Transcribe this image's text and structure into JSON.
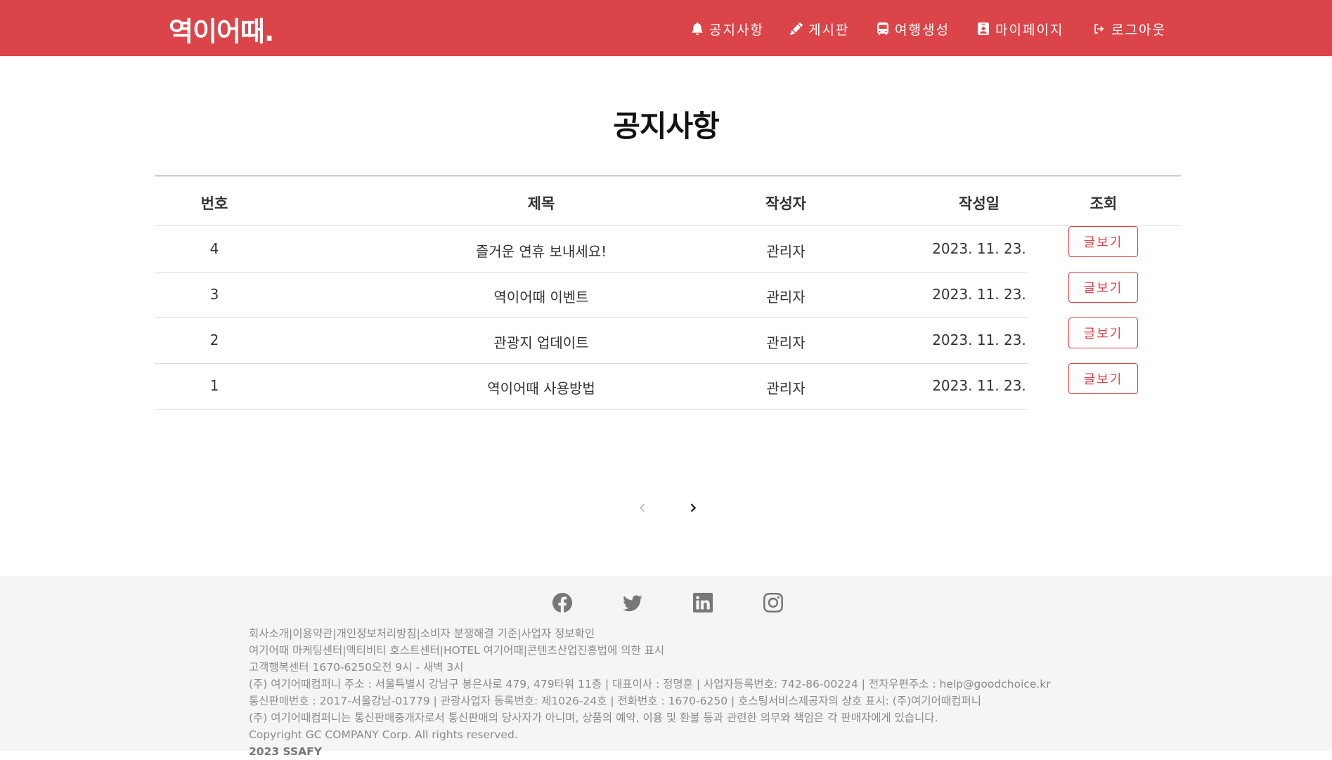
{
  "header": {
    "brand": "역이어때.",
    "nav": [
      {
        "label": "공지사항",
        "icon": "bell-icon"
      },
      {
        "label": "게시판",
        "icon": "pencil-icon"
      },
      {
        "label": "여행생성",
        "icon": "bus-icon"
      },
      {
        "label": "마이페이지",
        "icon": "user-badge-icon"
      },
      {
        "label": "로그아웃",
        "icon": "logout-icon"
      }
    ]
  },
  "page": {
    "title": "공지사항"
  },
  "table": {
    "headers": [
      "번호",
      "제목",
      "작성자",
      "작성일",
      "조회"
    ],
    "rows": [
      {
        "no": "4",
        "title": "즐거운 연휴 보내세요!",
        "author": "관리자",
        "date": "2023. 11. 23.",
        "action": "글보기"
      },
      {
        "no": "3",
        "title": "역이어때 이벤트",
        "author": "관리자",
        "date": "2023. 11. 23.",
        "action": "글보기"
      },
      {
        "no": "2",
        "title": "관광지 업데이트",
        "author": "관리자",
        "date": "2023. 11. 23.",
        "action": "글보기"
      },
      {
        "no": "1",
        "title": "역이어때 사용방법",
        "author": "관리자",
        "date": "2023. 11. 23.",
        "action": "글보기"
      }
    ]
  },
  "pagination": {
    "prev_icon": "chevron-left-icon",
    "next_icon": "chevron-right-icon"
  },
  "footer": {
    "socials": [
      "facebook-icon",
      "twitter-icon",
      "linkedin-icon",
      "instagram-icon"
    ],
    "links": [
      "회사소개",
      "이용약관",
      "개인정보처리방침",
      "소비자 분쟁해결 기준",
      "사업자 정보확인"
    ],
    "lines": [
      "여기어때 마케팅센터|액티비티 호스트센터|HOTEL 여기어때|콘텐츠산업진흥법에 의한 표시",
      "고객행복센터 1670-6250오전 9시 - 새벽 3시",
      "(주) 여기어때컴퍼니 주소 : 서울특별시 강남구 봉은사로 479, 479타워 11층 | 대표이사 : 정명훈 | 사업자등록번호: 742-86-00224 | 전자우편주소 : help@goodchoice.kr",
      "통신판매번호 : 2017-서울강남-01779 | 관광사업자 등록번호: 제1026-24호 | 전화번호 : 1670-6250 | 호스팅서비스제공자의 상호 표시: (주)여기어때컴퍼니",
      "(주) 여기어때컴퍼니는 통신판매중개자로서 통신판매의 당사자가 아니며, 상품의 예약, 이용 및 환불 등과 관련한 의무와 책임은 각 판매자에게 있습니다.",
      "Copyright GC COMPANY Corp. All rights reserved."
    ],
    "last_line": "2023 SSAFY"
  },
  "colors": {
    "brand": "#db4549",
    "footer_bg": "#f5f5f5"
  }
}
